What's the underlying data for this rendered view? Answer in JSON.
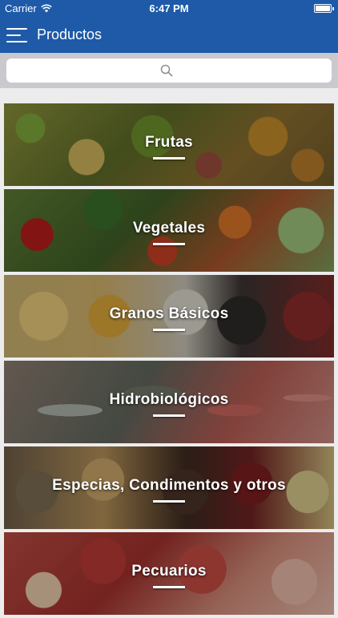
{
  "status_bar": {
    "carrier": "Carrier",
    "time": "6:47 PM"
  },
  "nav": {
    "title": "Productos"
  },
  "search": {
    "placeholder": ""
  },
  "categories": [
    {
      "label": "Frutas"
    },
    {
      "label": "Vegetales"
    },
    {
      "label": "Granos Básicos"
    },
    {
      "label": "Hidrobiológicos"
    },
    {
      "label": "Especias, Condimentos y otros"
    },
    {
      "label": "Pecuarios"
    }
  ],
  "colors": {
    "nav_background": "#1e5aa8",
    "search_background": "#c9c9ce"
  }
}
